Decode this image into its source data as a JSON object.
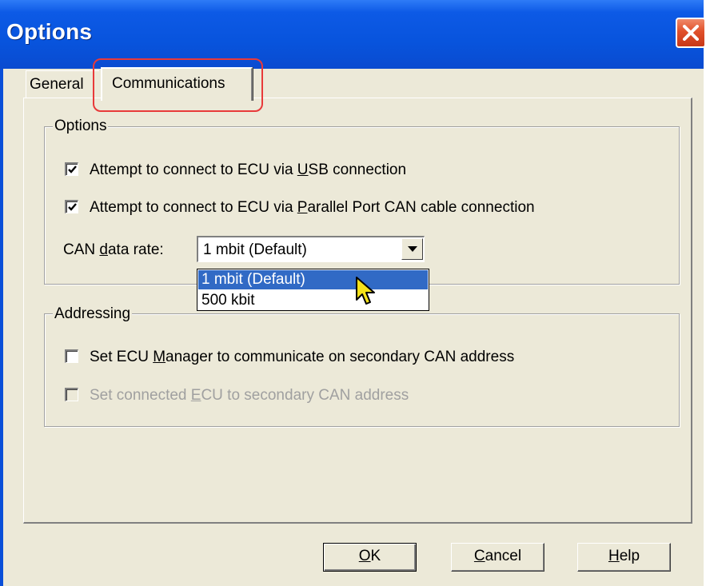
{
  "window": {
    "title": "Options"
  },
  "tabs": [
    {
      "label": "General",
      "active": false
    },
    {
      "label": "Communications",
      "active": true
    }
  ],
  "options_group": {
    "label": "Options",
    "usb": {
      "prefix": "Attempt to connect to ECU via ",
      "mnemonic": "U",
      "suffix": "SB connection",
      "checked": true
    },
    "parallel": {
      "prefix": "Attempt to connect to ECU via ",
      "mnemonic": "P",
      "suffix": "arallel Port CAN cable connection",
      "checked": true
    },
    "can_rate": {
      "label_prefix": "CAN ",
      "label_mnemonic": "d",
      "label_suffix": "ata rate:",
      "value": "1 mbit (Default)",
      "options": [
        "1 mbit (Default)",
        "500 kbit"
      ]
    }
  },
  "addressing_group": {
    "label": "Addressing",
    "manager": {
      "prefix": "Set ECU ",
      "mnemonic": "M",
      "suffix": "anager to communicate on secondary CAN address",
      "checked": false
    },
    "connected": {
      "prefix": "Set connected ",
      "mnemonic": "E",
      "suffix": "CU to secondary CAN address",
      "checked": false,
      "disabled": true
    }
  },
  "buttons": {
    "ok": {
      "mnemonic": "O",
      "suffix": "K"
    },
    "cancel": {
      "mnemonic": "C",
      "suffix": "ancel"
    },
    "help": {
      "mnemonic": "H",
      "suffix": "elp"
    }
  },
  "colors": {
    "titlebar": "#0854dd",
    "selection": "#316ac5",
    "highlight_outline": "#e83a3a",
    "dialog_bg": "#ece9d8"
  }
}
